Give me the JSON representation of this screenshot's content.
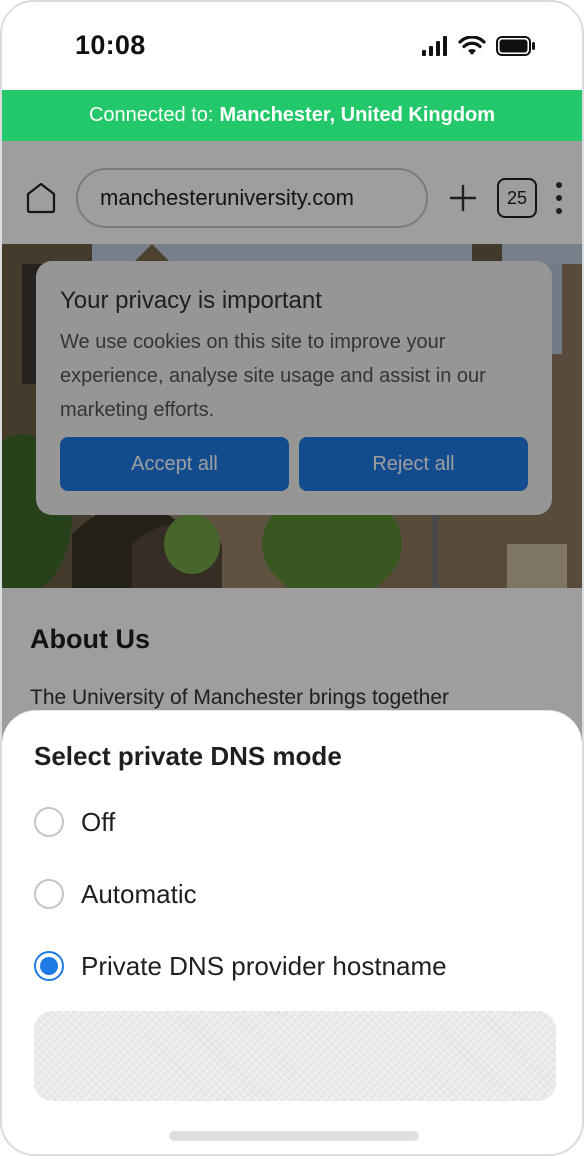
{
  "status_bar": {
    "time": "10:08"
  },
  "vpn_banner": {
    "prefix": "Connected to:",
    "location": "Manchester, United Kingdom"
  },
  "browser": {
    "url": "manchesteruniversity.com",
    "tab_count": "25"
  },
  "cookie_dialog": {
    "title": "Your privacy is important",
    "text": "We use cookies on this site to improve your experience, analyse site usage and assist in our marketing efforts.",
    "accept_label": "Accept all",
    "reject_label": "Reject all"
  },
  "page": {
    "about_title": "About Us",
    "about_text": "The University of Manchester brings together"
  },
  "dns_sheet": {
    "title": "Select private DNS mode",
    "options": [
      {
        "label": "Off",
        "selected": false
      },
      {
        "label": "Automatic",
        "selected": false
      },
      {
        "label": "Private DNS provider hostname",
        "selected": true
      }
    ]
  },
  "colors": {
    "accent": "#1e7be6",
    "vpn_green": "#23c86a"
  },
  "icons": [
    "cellular-signal-icon",
    "wifi-icon",
    "battery-icon",
    "home-icon",
    "plus-icon",
    "tabs-icon",
    "more-vert-icon"
  ]
}
